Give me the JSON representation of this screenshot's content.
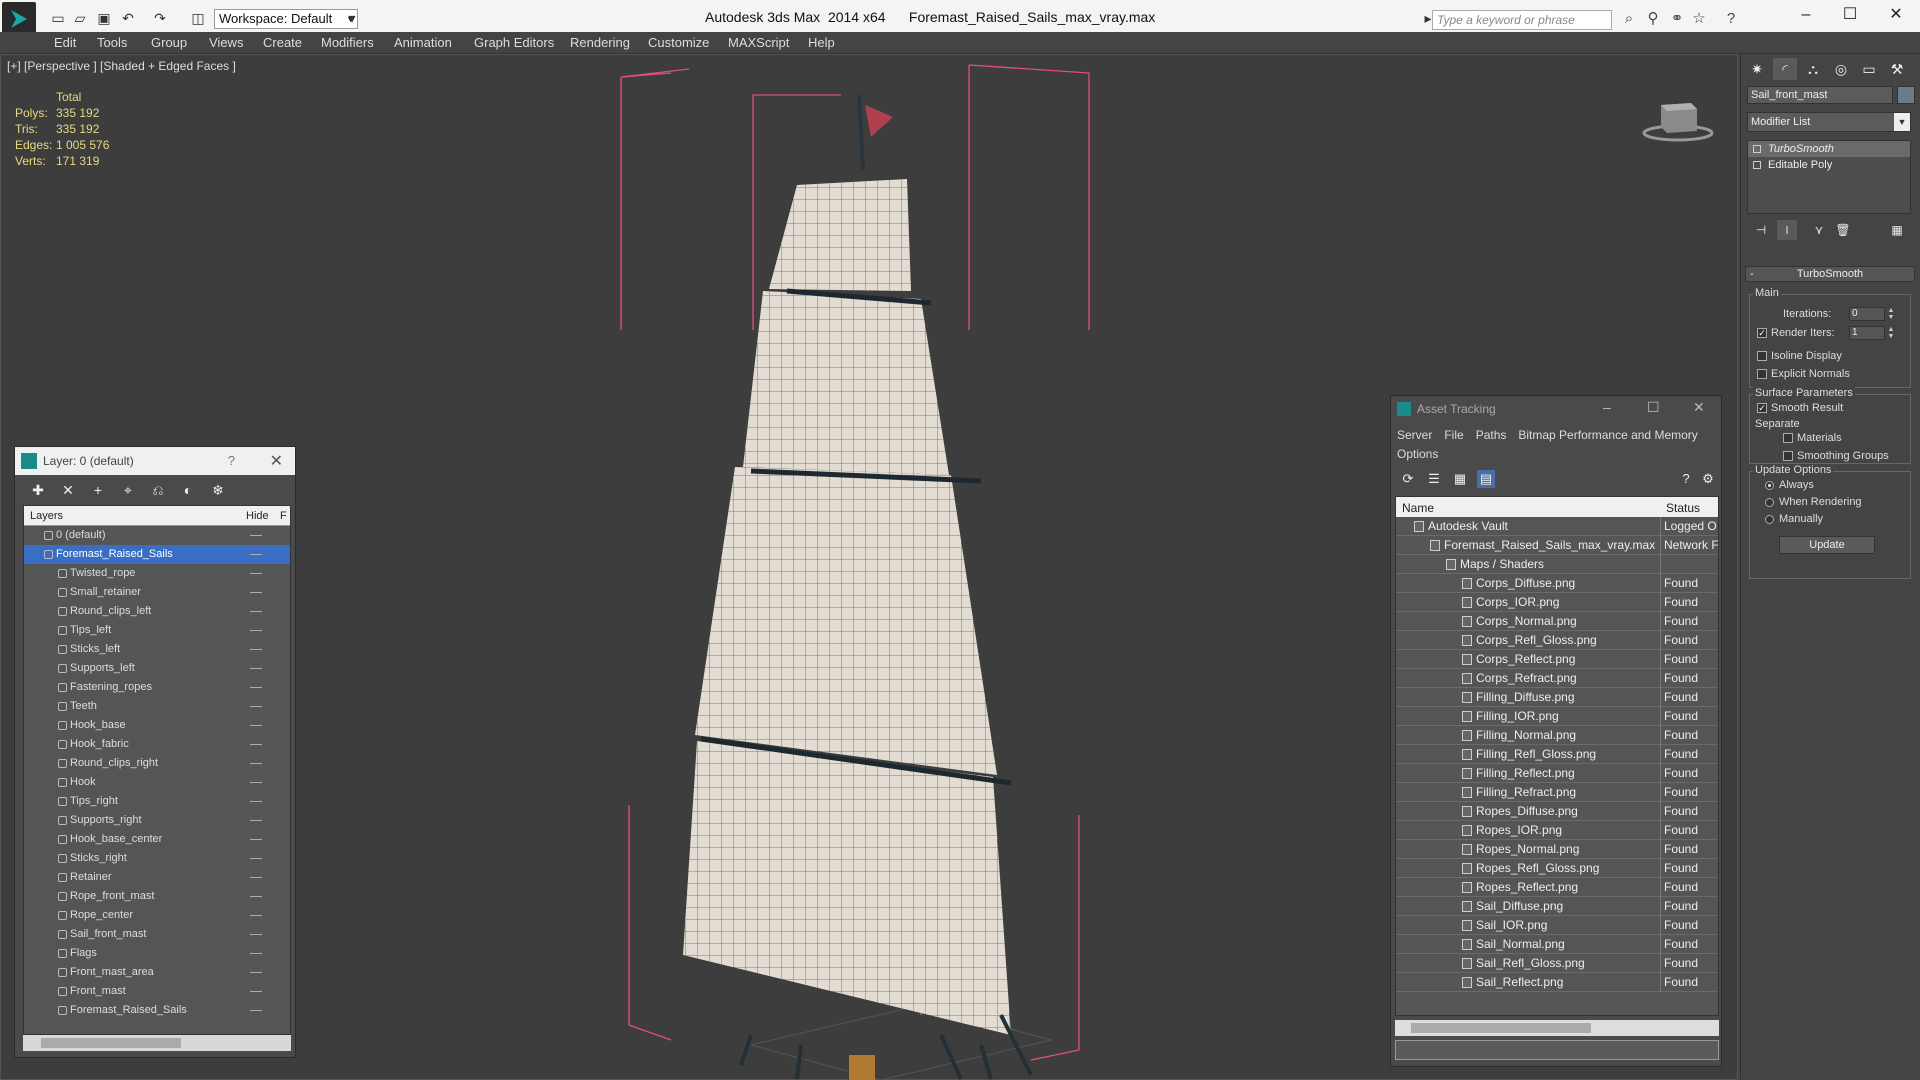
{
  "app": {
    "title": "Autodesk 3ds Max  2014 x64      Foremast_Raised_Sails_max_vray.max",
    "workspace": "Workspace: Default",
    "search_placeholder": "Type a keyword or phrase"
  },
  "menu": [
    "Edit",
    "Tools",
    "Group",
    "Views",
    "Create",
    "Modifiers",
    "Animation",
    "Graph Editors",
    "Rendering",
    "Customize",
    "MAXScript",
    "Help"
  ],
  "viewport": {
    "label": "[+] [Perspective ] [Shaded + Edged Faces ]",
    "stats_header": "Total",
    "stats": [
      {
        "label": "Polys:",
        "value": "335 192"
      },
      {
        "label": "Tris:",
        "value": "335 192"
      },
      {
        "label": "Edges:",
        "value": "1 005 576"
      },
      {
        "label": "Verts:",
        "value": "171 319"
      }
    ]
  },
  "layer_panel": {
    "title": "Layer: 0 (default)",
    "help": "?",
    "col_layers": "Layers",
    "col_hide": "Hide",
    "col_f": "F",
    "layers": [
      {
        "name": "0 (default)",
        "top": true,
        "selected": false
      },
      {
        "name": "Foremast_Raised_Sails",
        "top": true,
        "selected": true
      },
      {
        "name": "Twisted_rope"
      },
      {
        "name": "Small_retainer"
      },
      {
        "name": "Round_clips_left"
      },
      {
        "name": "Tips_left"
      },
      {
        "name": "Sticks_left"
      },
      {
        "name": "Supports_left"
      },
      {
        "name": "Fastening_ropes"
      },
      {
        "name": "Teeth"
      },
      {
        "name": "Hook_base"
      },
      {
        "name": "Hook_fabric"
      },
      {
        "name": "Round_clips_right"
      },
      {
        "name": "Hook"
      },
      {
        "name": "Tips_right"
      },
      {
        "name": "Supports_right"
      },
      {
        "name": "Hook_base_center"
      },
      {
        "name": "Sticks_right"
      },
      {
        "name": "Retainer"
      },
      {
        "name": "Rope_front_mast"
      },
      {
        "name": "Rope_center"
      },
      {
        "name": "Sail_front_mast"
      },
      {
        "name": "Flags"
      },
      {
        "name": "Front_mast_area"
      },
      {
        "name": "Front_mast"
      },
      {
        "name": "Foremast_Raised_Sails"
      }
    ]
  },
  "asset_panel": {
    "title": "Asset Tracking",
    "menu": [
      "Server",
      "File",
      "Paths",
      "Bitmap Performance and Memory",
      "Options"
    ],
    "col_name": "Name",
    "col_status": "Status",
    "rows": [
      {
        "name": "Autodesk Vault",
        "status": "Logged O",
        "indent": 1
      },
      {
        "name": "Foremast_Raised_Sails_max_vray.max",
        "status": "Network F",
        "indent": 2
      },
      {
        "name": "Maps / Shaders",
        "status": "",
        "indent": 3
      },
      {
        "name": "Corps_Diffuse.png",
        "status": "Found",
        "indent": 4
      },
      {
        "name": "Corps_IOR.png",
        "status": "Found",
        "indent": 4
      },
      {
        "name": "Corps_Normal.png",
        "status": "Found",
        "indent": 4
      },
      {
        "name": "Corps_Refl_Gloss.png",
        "status": "Found",
        "indent": 4
      },
      {
        "name": "Corps_Reflect.png",
        "status": "Found",
        "indent": 4
      },
      {
        "name": "Corps_Refract.png",
        "status": "Found",
        "indent": 4
      },
      {
        "name": "Filling_Diffuse.png",
        "status": "Found",
        "indent": 4
      },
      {
        "name": "Filling_IOR.png",
        "status": "Found",
        "indent": 4
      },
      {
        "name": "Filling_Normal.png",
        "status": "Found",
        "indent": 4
      },
      {
        "name": "Filling_Refl_Gloss.png",
        "status": "Found",
        "indent": 4
      },
      {
        "name": "Filling_Reflect.png",
        "status": "Found",
        "indent": 4
      },
      {
        "name": "Filling_Refract.png",
        "status": "Found",
        "indent": 4
      },
      {
        "name": "Ropes_Diffuse.png",
        "status": "Found",
        "indent": 4
      },
      {
        "name": "Ropes_IOR.png",
        "status": "Found",
        "indent": 4
      },
      {
        "name": "Ropes_Normal.png",
        "status": "Found",
        "indent": 4
      },
      {
        "name": "Ropes_Refl_Gloss.png",
        "status": "Found",
        "indent": 4
      },
      {
        "name": "Ropes_Reflect.png",
        "status": "Found",
        "indent": 4
      },
      {
        "name": "Sail_Diffuse.png",
        "status": "Found",
        "indent": 4
      },
      {
        "name": "Sail_IOR.png",
        "status": "Found",
        "indent": 4
      },
      {
        "name": "Sail_Normal.png",
        "status": "Found",
        "indent": 4
      },
      {
        "name": "Sail_Refl_Gloss.png",
        "status": "Found",
        "indent": 4
      },
      {
        "name": "Sail_Reflect.png",
        "status": "Found",
        "indent": 4
      }
    ]
  },
  "command_panel": {
    "object_name": "Sail_front_mast",
    "modifier_list": "Modifier List",
    "stack": [
      {
        "name": "TurboSmooth",
        "selected": true
      },
      {
        "name": "Editable Poly",
        "selected": false
      }
    ],
    "turbosmooth": {
      "title": "TurboSmooth",
      "main": "Main",
      "iterations_label": "Iterations:",
      "iterations": "0",
      "render_iters_label": "Render Iters:",
      "render_iters": "1",
      "isoline": "Isoline Display",
      "explicit_normals": "Explicit Normals",
      "surface_params": "Surface Parameters",
      "smooth_result": "Smooth Result",
      "separate": "Separate",
      "materials": "Materials",
      "smoothing_groups": "Smoothing Groups",
      "update_options": "Update Options",
      "always": "Always",
      "when_rendering": "When Rendering",
      "manually": "Manually",
      "update": "Update"
    }
  },
  "colors": {
    "selection": "#3a6ec4",
    "stats_text": "#e8d980",
    "bbox": "#e0507a",
    "sail": "#e2dcd2"
  }
}
